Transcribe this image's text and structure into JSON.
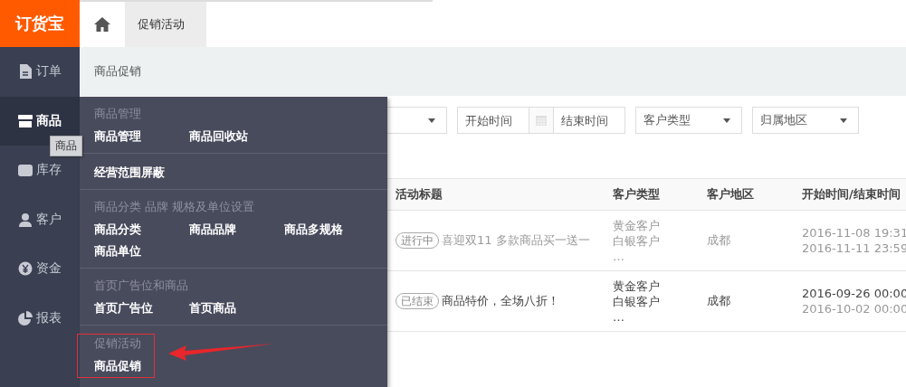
{
  "logo": "订货宝",
  "top_tabs": [
    {
      "kind": "home",
      "selected": false
    },
    {
      "kind": "text",
      "label": "促销活动",
      "selected": true
    }
  ],
  "breadcrumb": "商品促销",
  "sidebar": {
    "items": [
      {
        "kind": "orders",
        "label": "订单",
        "selected": false
      },
      {
        "kind": "goods",
        "label": "商品",
        "selected": true
      },
      {
        "kind": "stock",
        "label": "库存",
        "selected": false
      },
      {
        "kind": "customers",
        "label": "客户",
        "selected": false
      },
      {
        "kind": "funds",
        "label": "资金",
        "selected": false
      },
      {
        "kind": "reports",
        "label": "报表",
        "selected": false
      }
    ]
  },
  "tooltip": "商品",
  "filters": [
    {
      "kind": "select"
    },
    {
      "kind": "daterange",
      "start_placeholder": "开始时间",
      "end_placeholder": "结束时间"
    },
    {
      "kind": "select",
      "placeholder": "客户类型"
    },
    {
      "kind": "select",
      "placeholder": "归属地区"
    }
  ],
  "table": {
    "columns": [
      "活动标题",
      "客户类型",
      "客户地区",
      "开始时间/结束时间"
    ],
    "rows": [
      {
        "status": "进行中",
        "title": "喜迎双11 多款商品买一送一",
        "customer_types": [
          "黄金客户",
          "白银客户",
          "…"
        ],
        "region": "成都",
        "start": "2016-11-08 19:31",
        "end": "2016-11-11 23:59",
        "dimmed": true
      },
      {
        "status": "已结束",
        "title": "商品特价，全场八折！",
        "customer_types": [
          "黄金客户",
          "白银客户",
          "…"
        ],
        "region": "成都",
        "start": "2016-09-26 00:00",
        "end": "2016-10-02 00:00",
        "dimmed": false
      }
    ]
  },
  "menu": {
    "sections": [
      {
        "heading": "商品管理",
        "links": [
          {
            "label": "商品管理",
            "highlighted": false
          },
          {
            "label": "商品回收站",
            "highlighted": false
          }
        ]
      },
      {
        "links": [
          {
            "label": "经营范围屏蔽",
            "highlighted": false
          }
        ]
      },
      {
        "heading": "商品分类 品牌 规格及单位设置",
        "links": [
          {
            "label": "商品分类",
            "highlighted": false
          },
          {
            "label": "商品品牌",
            "highlighted": false
          },
          {
            "label": "商品多规格",
            "highlighted": false
          },
          {
            "label": "商品单位",
            "highlighted": false
          }
        ]
      },
      {
        "heading": "首页广告位和商品",
        "links": [
          {
            "label": "首页广告位",
            "highlighted": false
          },
          {
            "label": "首页商品",
            "highlighted": false
          }
        ]
      },
      {
        "heading": "促销活动",
        "highlighted": true,
        "links": [
          {
            "label": "商品促销",
            "highlighted": false
          }
        ]
      }
    ]
  }
}
